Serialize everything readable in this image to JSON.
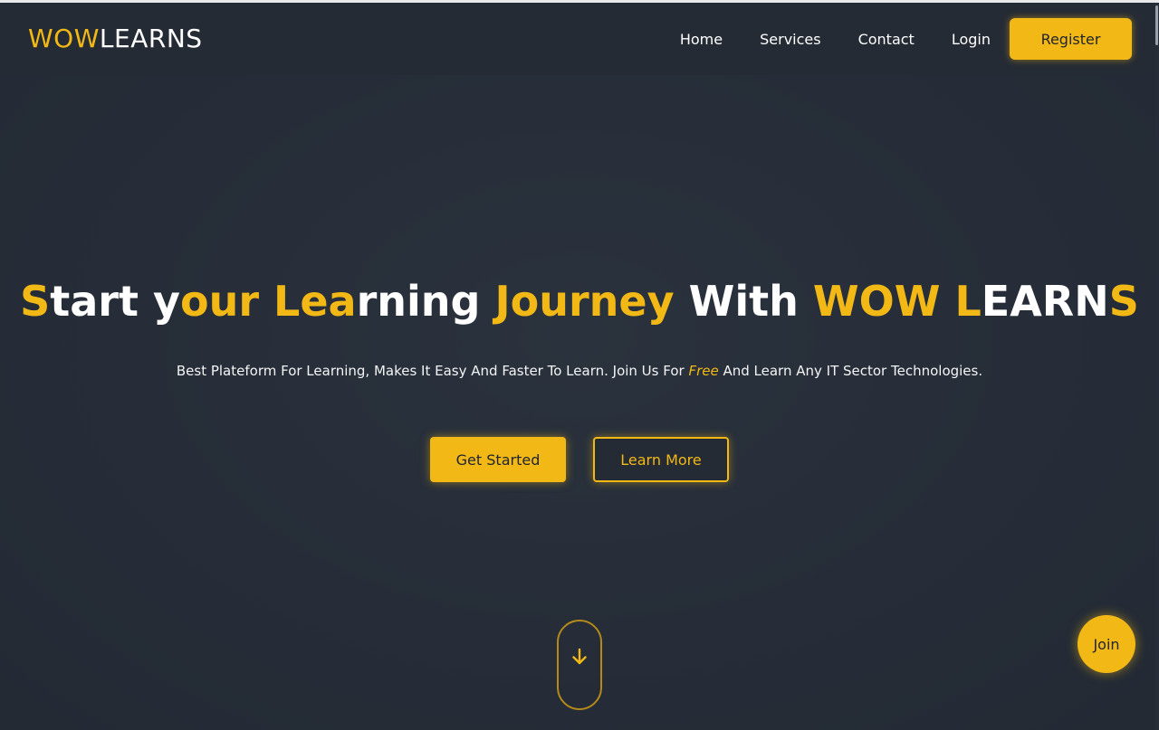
{
  "brand": {
    "logo_part1": "WOW",
    "logo_part2": "LEARNS",
    "accent_color": "#f2b916",
    "background_color": "#262d38"
  },
  "nav": {
    "items": [
      {
        "label": "Home"
      },
      {
        "label": "Services"
      },
      {
        "label": "Contact"
      },
      {
        "label": "Login"
      }
    ],
    "register_label": "Register"
  },
  "hero": {
    "headline_segments": [
      {
        "text": "S",
        "accent": true
      },
      {
        "text": "tart y",
        "accent": false
      },
      {
        "text": "our Lea",
        "accent": true
      },
      {
        "text": "rning ",
        "accent": false
      },
      {
        "text": "Journey",
        "accent": true
      },
      {
        "text": " With ",
        "accent": false
      },
      {
        "text": "WOW L",
        "accent": true
      },
      {
        "text": "EARN",
        "accent": false
      },
      {
        "text": "S",
        "accent": true
      }
    ],
    "subtitle_before": "Best Plateform For Learning, Makes It Easy And Faster To Learn. Join Us For ",
    "subtitle_highlight": "Free",
    "subtitle_after": " And Learn Any IT Sector Technologies.",
    "primary_cta": "Get Started",
    "secondary_cta": "Learn More"
  },
  "scroll_indicator": {
    "icon": "arrow-down-icon"
  },
  "join_fab": {
    "label": "Join"
  }
}
